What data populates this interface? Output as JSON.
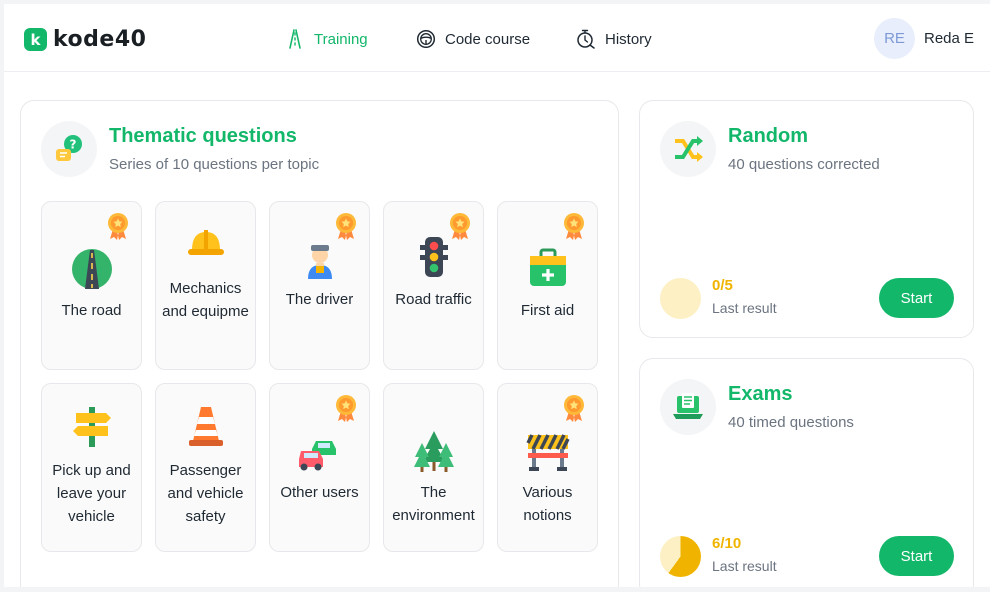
{
  "header": {
    "logo_badge": "k",
    "logo_text": "kode40",
    "nav": [
      {
        "label": "Training",
        "icon": "road-icon",
        "active": true
      },
      {
        "label": "Code course",
        "icon": "steering-wheel-icon",
        "active": false
      },
      {
        "label": "History",
        "icon": "stopwatch-icon",
        "active": false
      }
    ],
    "user": {
      "initials": "RE",
      "name": "Reda E"
    }
  },
  "thematic": {
    "title": "Thematic questions",
    "subtitle": "Series of 10 questions per topic",
    "topics": [
      {
        "label": "The road",
        "icon": "road-icon",
        "medal": true
      },
      {
        "label": "Mechanics and equipme",
        "icon": "hard-hat-icon",
        "medal": false
      },
      {
        "label": "The driver",
        "icon": "driver-icon",
        "medal": true
      },
      {
        "label": "Road traffic",
        "icon": "traffic-light-icon",
        "medal": true
      },
      {
        "label": "First aid",
        "icon": "first-aid-kit-icon",
        "medal": true
      },
      {
        "label": "Pick up and leave your vehicle",
        "icon": "signpost-icon",
        "medal": false
      },
      {
        "label": "Passenger and vehicle safety",
        "icon": "traffic-cone-icon",
        "medal": false
      },
      {
        "label": "Other users",
        "icon": "cars-icon",
        "medal": true
      },
      {
        "label": "The environment",
        "icon": "trees-icon",
        "medal": false
      },
      {
        "label": "Various notions",
        "icon": "road-barrier-icon",
        "medal": true
      }
    ]
  },
  "random": {
    "title": "Random",
    "subtitle": "40 questions corrected",
    "score": "0/5",
    "score_fraction": 0,
    "result_label": "Last result",
    "button": "Start"
  },
  "exams": {
    "title": "Exams",
    "subtitle": "40 timed questions",
    "score": "6/10",
    "score_fraction": 0.6,
    "result_label": "Last result",
    "button": "Start"
  },
  "colors": {
    "accent": "#12b76a",
    "score": "#f0b400",
    "pie_track": "#fdf0c4"
  }
}
